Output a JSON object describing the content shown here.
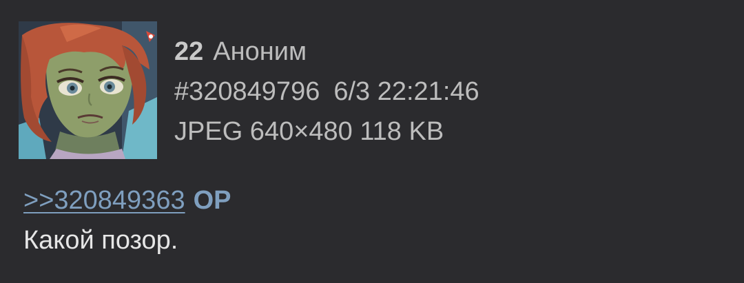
{
  "post": {
    "number": "22",
    "author": "Аноним",
    "id": "#320849796",
    "date": "6/3 22:21:46",
    "file_info": "JPEG 640×480 118 KB",
    "reply_link": ">>320849363",
    "op_badge": "OP",
    "message": "Какой позор."
  },
  "thumbnail": {
    "icon": "anime-girl-thumbnail-image"
  },
  "colors": {
    "background": "#2b2b2e",
    "link": "#7f9fbf",
    "meta_text": "#bdbdbd",
    "body_text": "#e6e6e6"
  }
}
